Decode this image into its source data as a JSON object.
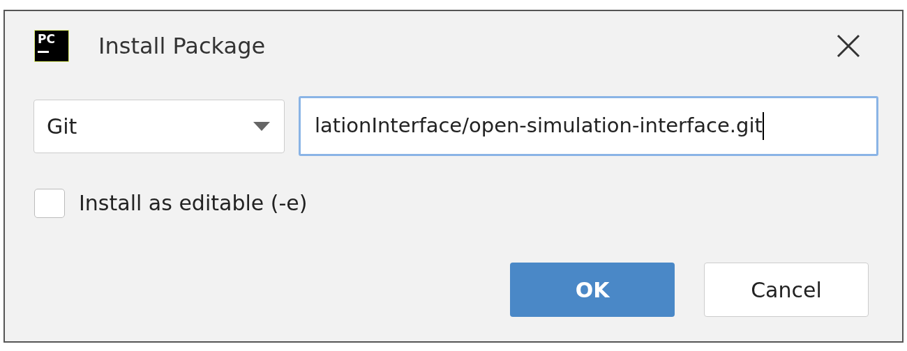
{
  "window": {
    "logo": "PC",
    "title": "Install Package"
  },
  "source": {
    "value": "Git"
  },
  "url": {
    "value": "lationInterface/open-simulation-interface.git",
    "focused": true
  },
  "editable": {
    "label": "Install as editable (-e)",
    "checked": false
  },
  "buttons": [
    {
      "label": "OK",
      "kind": "primary"
    },
    {
      "label": "Cancel",
      "kind": "secondary"
    }
  ]
}
